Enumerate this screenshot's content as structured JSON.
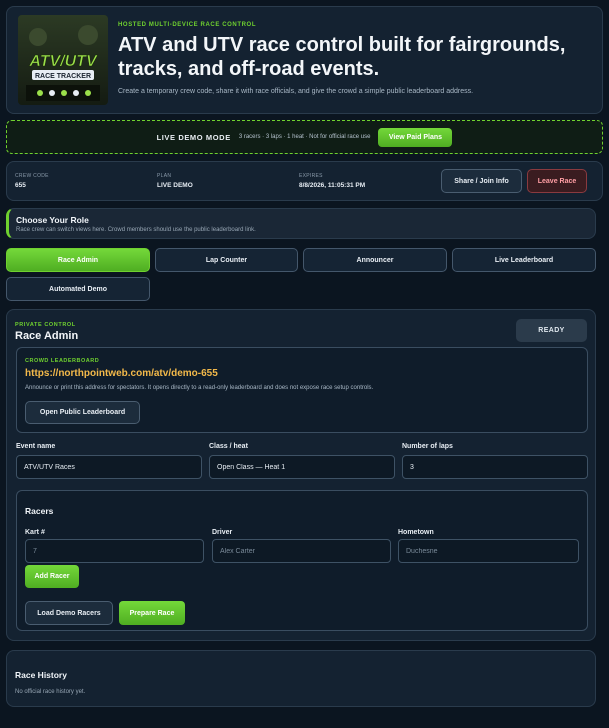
{
  "header": {
    "eyebrow": "HOSTED MULTI-DEVICE RACE CONTROL",
    "title": "ATV and UTV race control built for fairgrounds, tracks, and off-road events.",
    "subtitle": "Create a temporary crew code, share it with race officials, and give the crowd a simple public leaderboard address.",
    "logo": {
      "line1": "ATV/UTV",
      "line2": "RACE TRACKER"
    }
  },
  "demo_banner": {
    "label": "LIVE DEMO MODE",
    "info": "3 racers · 3 laps · 1 heat · Not for official race use",
    "button": "View Paid Plans"
  },
  "session": {
    "crew_code_label": "CREW CODE",
    "crew_code": "655",
    "plan_label": "PLAN",
    "plan": "LIVE DEMO",
    "expires_label": "EXPIRES",
    "expires": "8/8/2026, 11:05:31 PM",
    "share_button": "Share / Join Info",
    "leave_button": "Leave Race"
  },
  "role": {
    "title": "Choose Your Role",
    "subtitle": "Race crew can switch views here. Crowd members should use the public leaderboard link.",
    "tabs": [
      "Race Admin",
      "Lap Counter",
      "Announcer",
      "Live Leaderboard",
      "Automated Demo"
    ],
    "active": "Race Admin"
  },
  "admin": {
    "eyebrow": "PRIVATE CONTROL",
    "title": "Race Admin",
    "status": "READY",
    "crowd": {
      "label": "CROWD LEADERBOARD",
      "url": "https://northpointweb.com/atv/demo-655",
      "description": "Announce or print this address for spectators. It opens directly to a read-only leaderboard and does not expose race setup controls.",
      "button": "Open Public Leaderboard"
    },
    "event_name_label": "Event name",
    "event_name": "ATV/UTV Races",
    "class_label": "Class / heat",
    "class_value": "Open Class — Heat 1",
    "laps_label": "Number of laps",
    "laps_value": "3",
    "racers": {
      "title": "Racers",
      "kart_label": "Kart #",
      "kart_placeholder": "7",
      "driver_label": "Driver",
      "driver_placeholder": "Alex Carter",
      "hometown_label": "Hometown",
      "hometown_placeholder": "Duchesne",
      "add_button": "Add Racer",
      "load_demo_button": "Load Demo Racers",
      "prepare_button": "Prepare Race"
    }
  },
  "history": {
    "title": "Race History",
    "empty": "No official race history yet."
  },
  "colors": {
    "accent": "#6fd12f",
    "url": "#f3b94a",
    "background": "#0b1520",
    "panel": "#142231",
    "danger": "#ff9ea4"
  }
}
